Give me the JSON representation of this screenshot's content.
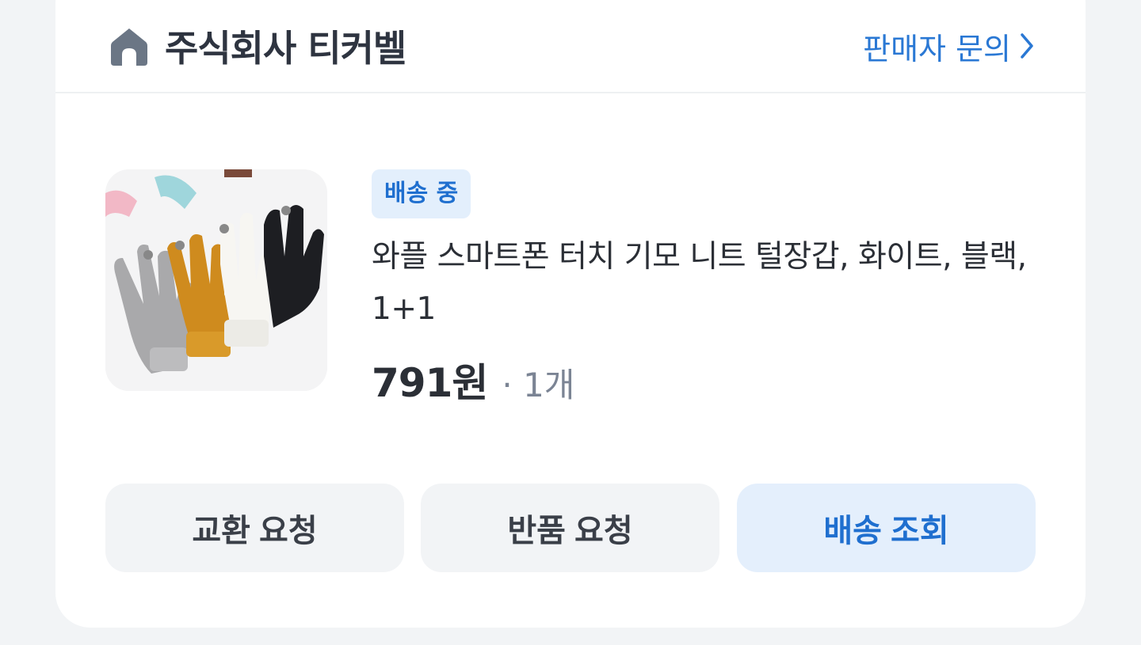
{
  "store": {
    "name": "주식회사 티커벨",
    "inquiry_label": "판매자 문의"
  },
  "order_item": {
    "status_badge": "배송 중",
    "title": "와플 스마트폰 터치 기모 니트 털장갑, 화이트, 블랙, 1+1",
    "price": "791원",
    "quantity": "· 1개"
  },
  "actions": {
    "exchange_label": "교환 요청",
    "return_label": "반품 요청",
    "tracking_label": "배송 조회"
  },
  "colors": {
    "accent": "#1f6fcf",
    "accent_bg": "#e3effc",
    "page_bg": "#f2f4f6"
  }
}
